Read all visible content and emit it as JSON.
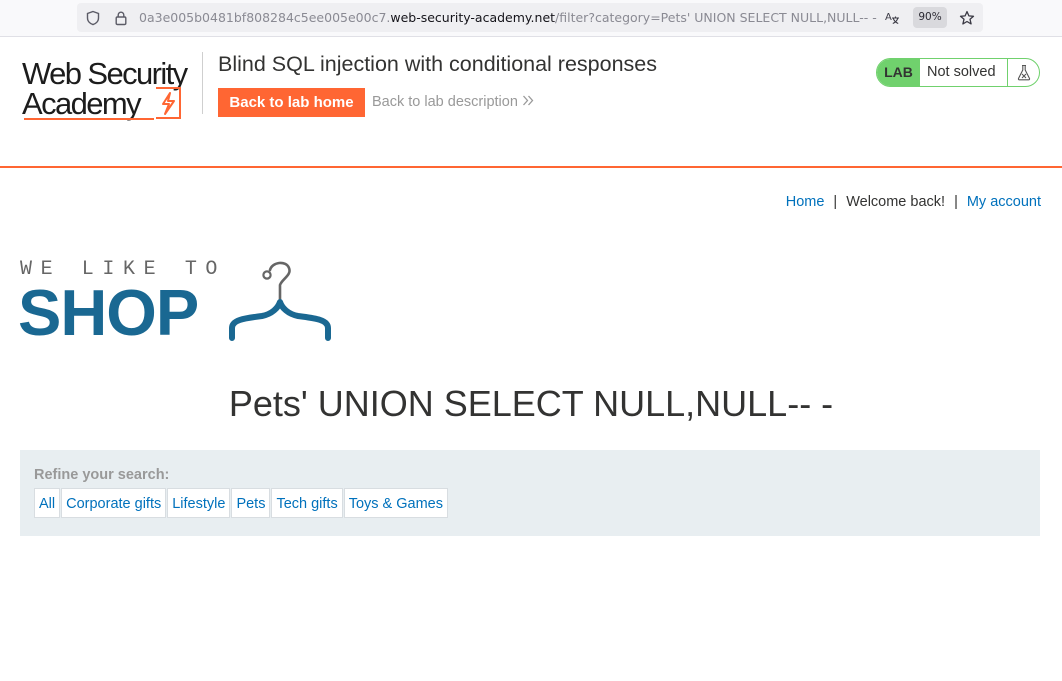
{
  "browser": {
    "url_prefix": "0a3e005b0481bf808284c5ee005e00c7.",
    "url_domain": "web-security-academy.net",
    "url_path": "/filter?category=Pets' UNION SELECT NULL,NULL-- -",
    "zoom": "90%",
    "icons": [
      "shield-icon",
      "lock-icon",
      "translate-icon",
      "star-icon"
    ]
  },
  "header": {
    "logo_line1": "Web Security",
    "logo_line2": "Academy",
    "lab_title": "Blind SQL injection with conditional responses",
    "back_home_label": "Back to lab home",
    "back_description_label": "Back to lab description",
    "lab_badge": "LAB",
    "lab_status": "Not solved",
    "accent_color": "#ff6633",
    "status_color": "#70d16d"
  },
  "nav": {
    "home": "Home",
    "separator": "|",
    "welcome": "Welcome back!",
    "account": "My account"
  },
  "banner": {
    "tagline": "WE LIKE TO",
    "word": "SHOP",
    "brand_color": "#1a6892"
  },
  "main": {
    "heading": "Pets' UNION SELECT NULL,NULL-- -"
  },
  "filters": {
    "label": "Refine your search:",
    "items": [
      "All",
      "Corporate gifts",
      "Lifestyle",
      "Pets",
      "Tech gifts",
      "Toys & Games"
    ]
  }
}
